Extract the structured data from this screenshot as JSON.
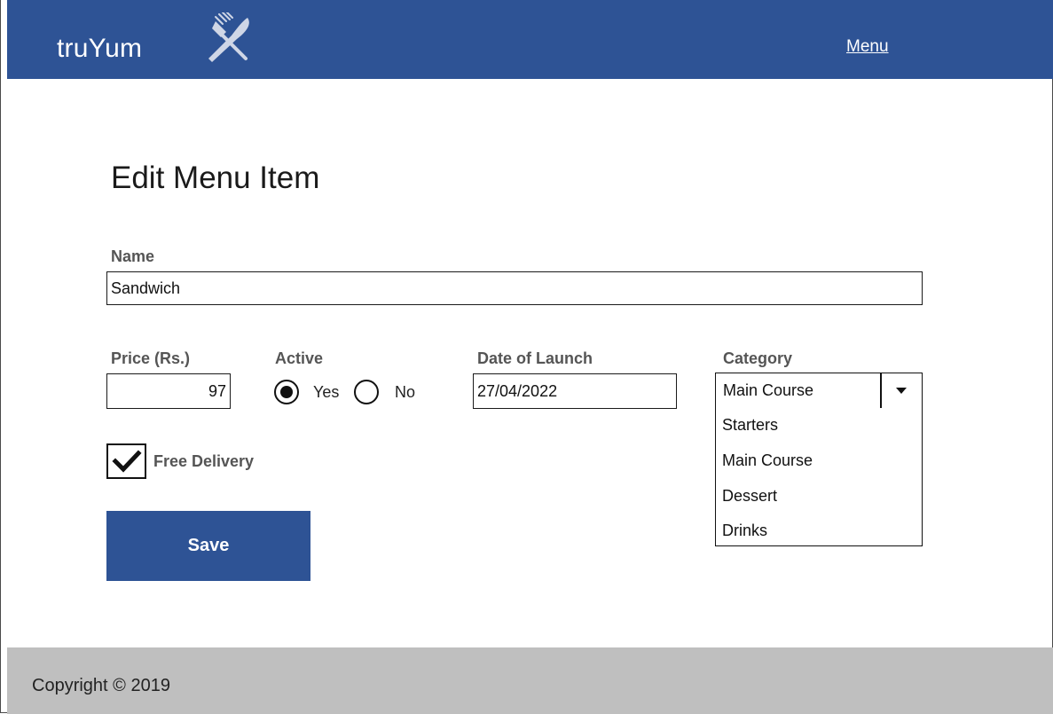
{
  "header": {
    "brand": "truYum",
    "brand_icon": "fork-knife-icon",
    "nav_menu": "Menu",
    "color": "#2e5395"
  },
  "page": {
    "title": "Edit Menu Item"
  },
  "form": {
    "name_label": "Name",
    "name_value": "Sandwich",
    "price_label": "Price (Rs.)",
    "price_value": "97",
    "active_label": "Active",
    "active_yes": "Yes",
    "active_no": "No",
    "active_selected": "Yes",
    "launch_label": "Date of Launch",
    "launch_value": "27/04/2022",
    "category_label": "Category",
    "category_value": "Main Course",
    "category_options": [
      "Starters",
      "Main Course",
      "Dessert",
      "Drinks"
    ],
    "free_delivery_label": "Free Delivery",
    "free_delivery_checked": true,
    "save_label": "Save"
  },
  "footer": {
    "copyright": "Copyright © 2019",
    "color": "#bfbfbf"
  }
}
